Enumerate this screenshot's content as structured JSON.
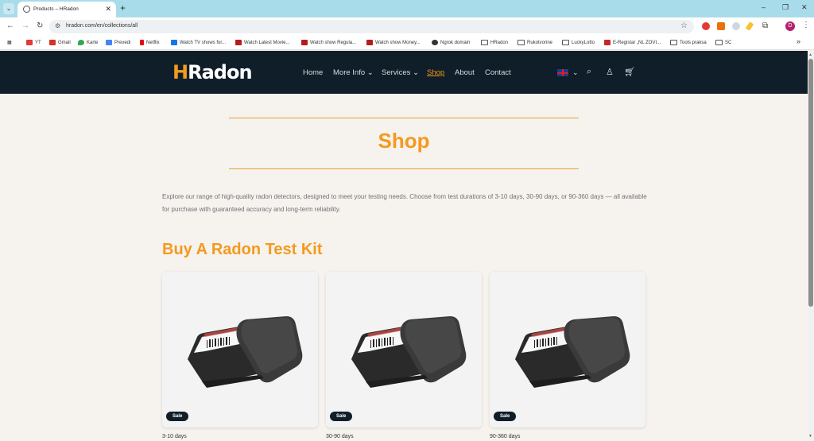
{
  "browser": {
    "tab_title": "Products – HRadon",
    "url": "hradon.com/en/collections/all",
    "tab_close": "✕",
    "new_tab": "+",
    "profile_initial": "D",
    "bookmarks": [
      {
        "label": "YT",
        "color": "#e53935"
      },
      {
        "label": "Gmail",
        "color": "#d93025"
      },
      {
        "label": "Karte",
        "color": "#34a853"
      },
      {
        "label": "Prevedi",
        "color": "#4285f4"
      },
      {
        "label": "Netflix",
        "color": "#e50914"
      },
      {
        "label": "Watch TV shows for...",
        "color": "#1a73e8"
      },
      {
        "label": "Watch Latest Movie...",
        "color": "#b71c1c"
      },
      {
        "label": "Watch show Regula...",
        "color": "#b71c1c"
      },
      {
        "label": "Watch show Money...",
        "color": "#b71c1c"
      },
      {
        "label": "Ngrok domain",
        "color": "#333333"
      },
      {
        "label": "HRadon",
        "folder": true
      },
      {
        "label": "Rukotvorine",
        "folder": true
      },
      {
        "label": "LuckyLotto",
        "folder": true
      },
      {
        "label": "E-Registar „NL ZOVI...",
        "color": "#c62828"
      },
      {
        "label": "Tools praksa",
        "folder": true
      },
      {
        "label": "SC",
        "folder": true
      }
    ]
  },
  "site": {
    "logo_h": "H",
    "logo_rest": "Radon",
    "nav": [
      {
        "label": "Home",
        "active": false
      },
      {
        "label": "More Info",
        "dropdown": true
      },
      {
        "label": "Services",
        "dropdown": true
      },
      {
        "label": "Shop",
        "active": true
      },
      {
        "label": "About",
        "active": false
      },
      {
        "label": "Contact",
        "active": false
      }
    ]
  },
  "main": {
    "title": "Shop",
    "intro": "Explore our range of high-quality radon detectors, designed to meet your testing needs. Choose from test durations of 3-10 days, 30-90 days, or 90-360 days — all available for purchase with guaranteed accuracy and long-term reliability.",
    "section_title": "Buy A Radon Test Kit",
    "products": [
      {
        "badge": "Sale",
        "caption": "3-10 days"
      },
      {
        "badge": "Sale",
        "caption": "30-90 days"
      },
      {
        "badge": "Sale",
        "caption": "90-360 days"
      }
    ]
  },
  "colors": {
    "brand_orange": "#f39a1e",
    "header_bg": "#0f1e28",
    "page_bg": "#f6f2ed"
  }
}
